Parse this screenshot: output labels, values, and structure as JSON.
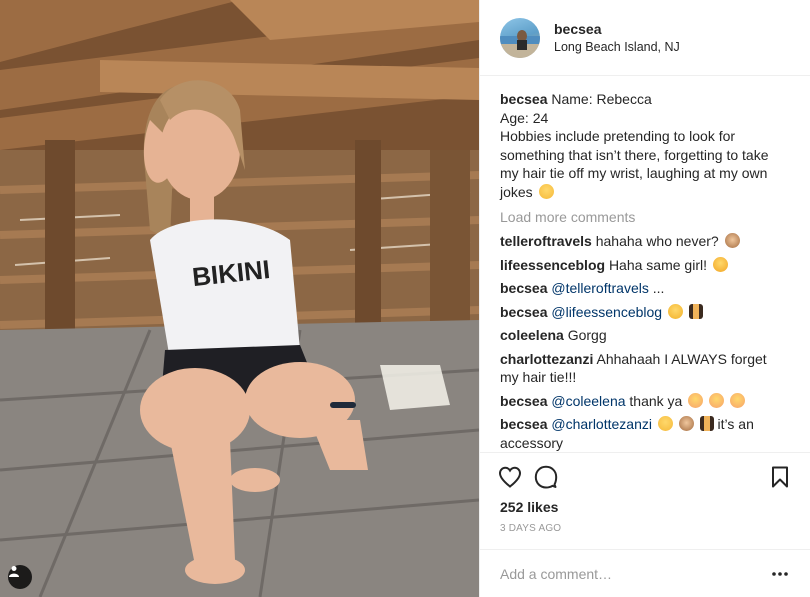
{
  "post": {
    "username": "becsea",
    "location": "Long Beach Island, NJ",
    "caption_lines": [
      "Name: Rebecca",
      "Age: 24",
      "Hobbies include pretending to look for",
      "something that isn’t there, forgetting to take",
      "my hair tie off my wrist, laughing at my own",
      "jokes"
    ],
    "load_more": "Load more comments",
    "comments": [
      {
        "user": "telleroftravels",
        "text": "hahaha who never?",
        "mention": "",
        "emojis": [
          "see-no-evil-monkey"
        ]
      },
      {
        "user": "lifeessenceblog",
        "text": "Haha same girl!",
        "mention": "",
        "emojis": [
          "tears-of-joy"
        ]
      },
      {
        "user": "becsea",
        "mention": "@telleroftravels",
        "text": "...",
        "emojis": []
      },
      {
        "user": "becsea",
        "mention": "@lifeessenceblog",
        "text": "",
        "emojis": [
          "winking-face",
          "dancers"
        ]
      },
      {
        "user": "coleelena",
        "text": "Gorgg",
        "mention": "",
        "emojis": []
      },
      {
        "user": "charlottezanzi",
        "text": "Ahhahaah I ALWAYS forget",
        "text2": "my hair tie!!!",
        "mention": "",
        "emojis": []
      },
      {
        "user": "becsea",
        "mention": "@coleelena",
        "text": "thank ya",
        "emojis": [
          "smiling-face",
          "smiling-face",
          "smiling-face"
        ]
      },
      {
        "user": "becsea",
        "mention": "@charlottezanzi",
        "text": "it’s an",
        "text2": "accessory",
        "emojis": [
          "grinning-sweat",
          "see-no-evil-monkey",
          "dancers"
        ]
      }
    ],
    "likes": "252 likes",
    "timestamp": "3 DAYS AGO",
    "add_comment_placeholder": "Add a comment…",
    "colors": {
      "text": "#262626",
      "muted": "#999999",
      "mention": "#003569",
      "border": "#efefef"
    },
    "icons": [
      "heart-icon",
      "comment-icon",
      "bookmark-icon",
      "more-options-icon",
      "user-tag-icon"
    ],
    "photo_shirt_text": "BIKINI"
  }
}
